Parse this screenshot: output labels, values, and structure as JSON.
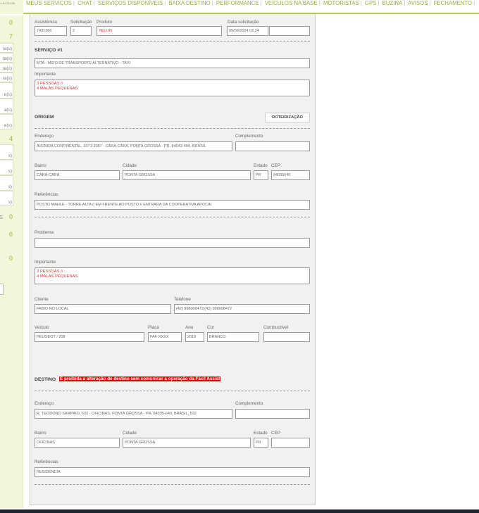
{
  "header": {
    "version": "1.10.70.190",
    "nav": [
      "MEUS SERVIÇOS",
      "CHAT",
      "SERVIÇOS DISPONÍVEIS",
      "BAIXA DESTINO",
      "PERFORMANCE",
      "VEÍCULOS NA BASE",
      "MOTORISTAS",
      "GPS",
      "BUZINA",
      "AVISOS",
      "FECHAMENTO"
    ]
  },
  "sidebar": {
    "counts": [
      "0",
      "7",
      "4",
      "0",
      "0",
      "0"
    ],
    "count_prefix": "s",
    "rows_a": [
      "ra(s)",
      "ra(s)",
      "ra(s)",
      "ra(s)"
    ],
    "rows_b": [
      "e(s)",
      "a(s)",
      "e(s)"
    ],
    "rows_c": [
      "s)",
      "s)",
      "s)",
      "s)"
    ]
  },
  "form": {
    "assistencia": {
      "label": "Assistência",
      "value": "7431266"
    },
    "solicitacao": {
      "label": "Solicitação",
      "value": "2"
    },
    "produto": {
      "label": "Produto",
      "value": "YELLIN"
    },
    "data": {
      "label": "Data solicitação",
      "value": "09/09/2024 02:24",
      "extra": ""
    },
    "servico_title": "SERVIÇO #1",
    "servico": "MTA - MEIO DE TRANSPORTE ALTERNATIVO - TAXI",
    "importante1": {
      "label": "Importante",
      "value": "3 PESSOAS //\n4 MALAS PEQUENAS"
    },
    "origem": {
      "title": "ORIGEM",
      "button": "ROTEIRIZAÇÃO",
      "endereco": {
        "label": "Endereço",
        "value": "AVENIDA CONTINENTAL, 2071-2087 - CARA-CARA, PONTA GROSSA - PR, 84043-450, BRASIL"
      },
      "complemento": {
        "label": "Complemento",
        "value": ""
      },
      "bairro": {
        "label": "Bairro",
        "value": "CARÁ-CARÁ"
      },
      "cidade": {
        "label": "Cidade",
        "value": "PONTA GROSSA"
      },
      "estado": {
        "label": "Estado",
        "value": "PR"
      },
      "cep": {
        "label": "CEP",
        "value": "84035640"
      },
      "referencias": {
        "label": "Referências",
        "value": "POSTO MAHLE - TORRE ALTA // EM FRENTE AO POSTO // ENTRADA DA COOPERATIVA APOCAI"
      }
    },
    "problema": {
      "label": "Problema",
      "value": ""
    },
    "importante2": {
      "label": "Importante",
      "value": "3 PESSOAS //\n4 MALAS PEQUENAS"
    },
    "cliente": {
      "label": "Cliente",
      "value": "FABIO NO LOCAL"
    },
    "telefone": {
      "label": "Telefone",
      "value": "(42) 998008472|(42) 998008472"
    },
    "veiculo": {
      "label": "Veículo",
      "value": "PEUGEOT / 208"
    },
    "placa": {
      "label": "Placa",
      "value": "FAF-XXXX"
    },
    "ano": {
      "label": "Ano",
      "value": "2016"
    },
    "cor": {
      "label": "Cor",
      "value": "BRANCO"
    },
    "combustivel": {
      "label": "Combustível",
      "value": ""
    },
    "destino": {
      "title": "DESTINO",
      "warning": "É proibida a alteração de destino sem comunicar a operação da Fácil Assist",
      "endereco": {
        "label": "Endereço",
        "value": "R. TEODORO SAMPAIO, 532 - OFICINAS, PONTA GROSSA - PR, 84035-640, BRASIL, 532"
      },
      "complemento": {
        "label": "Complemento",
        "value": ""
      },
      "bairro": {
        "label": "Bairro",
        "value": "OFICINAS"
      },
      "cidade": {
        "label": "Cidade",
        "value": "PONTA GROSSA"
      },
      "estado": {
        "label": "Estado",
        "value": "PR"
      },
      "cep": {
        "label": "CEP",
        "value": ""
      },
      "referencias": {
        "label": "Referências",
        "value": "RESIDENCIA"
      }
    }
  },
  "colors": {
    "accent": "#9aae3c",
    "warning": "#e00000"
  }
}
